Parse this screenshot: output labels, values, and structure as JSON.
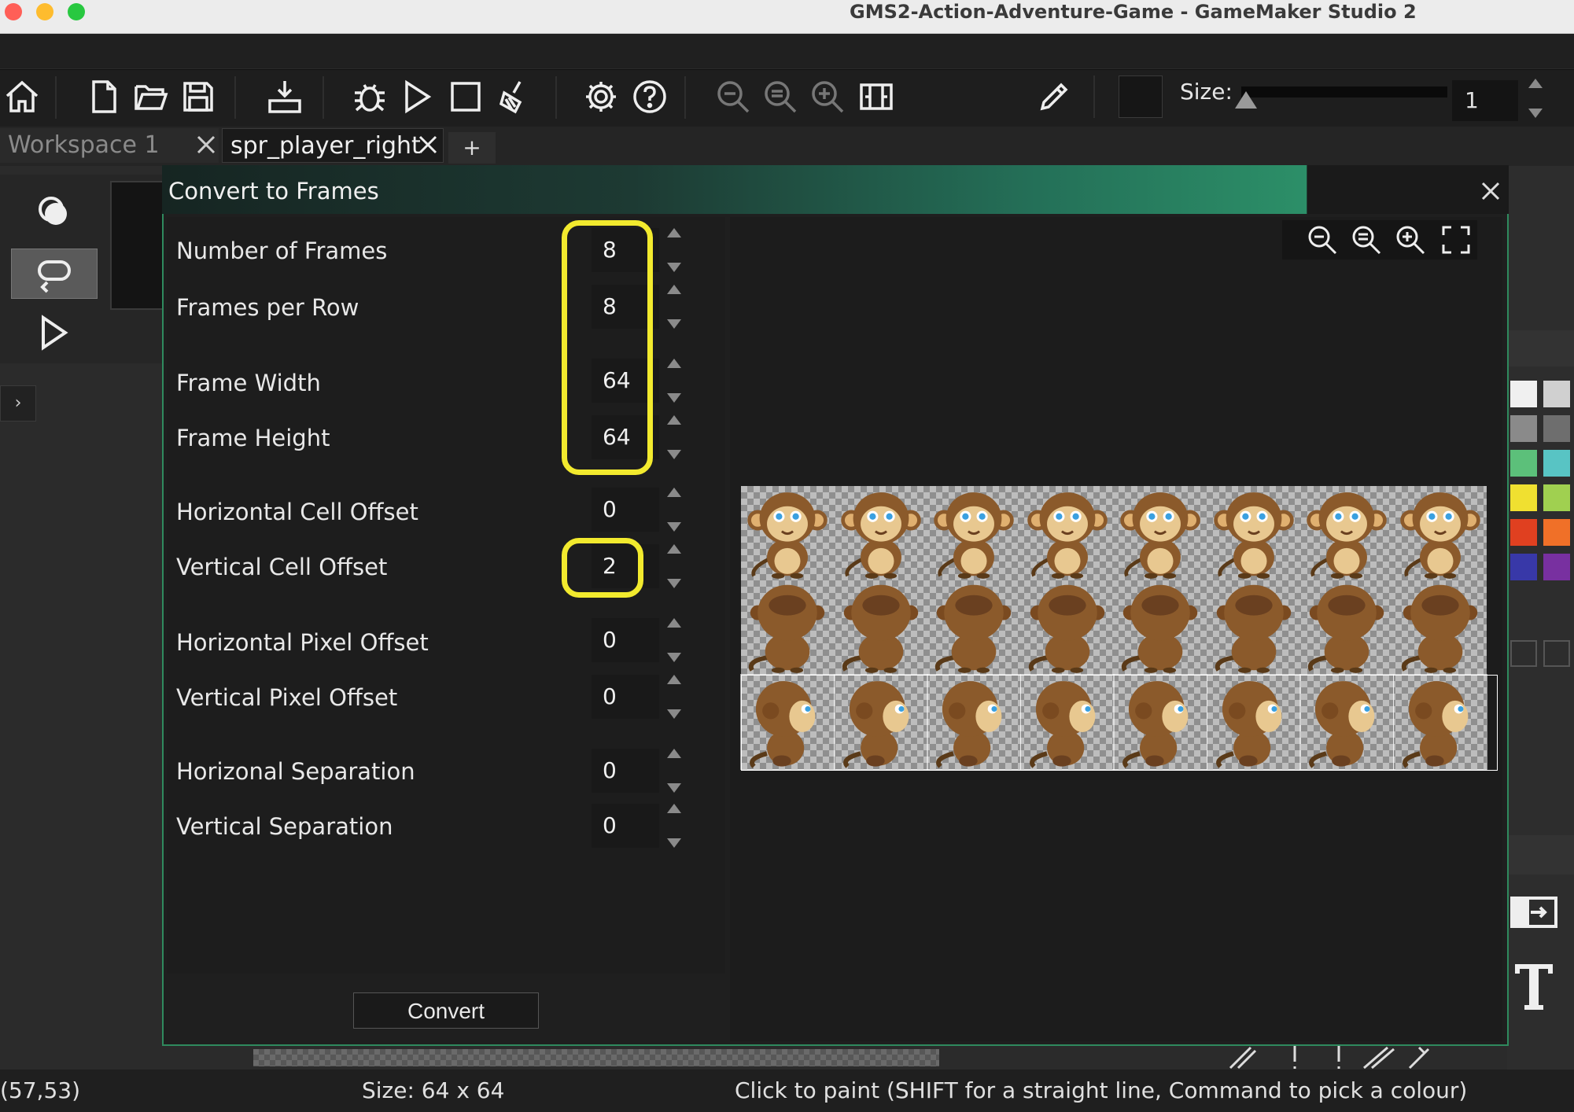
{
  "window": {
    "title": "GMS2-Action-Adventure-Game - GameMaker Studio 2",
    "traffic_colors": [
      "#ff5f57",
      "#febc2e",
      "#28c840"
    ]
  },
  "toolbar": {
    "icons": [
      "home-icon",
      "new-file-icon",
      "open-folder-icon",
      "save-icon",
      "export-icon",
      "debug-icon",
      "run-icon",
      "stop-icon",
      "clean-icon",
      "settings-icon",
      "help-icon",
      "zoom-out-icon",
      "zoom-reset-icon",
      "zoom-in-icon",
      "fit-icon",
      "pencil-icon"
    ],
    "size_label": "Size:",
    "size_value": "1"
  },
  "tabs": [
    {
      "label": "Workspace 1",
      "active": false
    },
    {
      "label": "spr_player_right",
      "active": true
    }
  ],
  "tab_add": "+",
  "left_tools": {
    "expand_glyph": "›"
  },
  "dialog": {
    "title": "Convert to Frames",
    "close": "✕",
    "fields": [
      {
        "label": "Number of Frames",
        "value": "8"
      },
      {
        "label": "Frames per Row",
        "value": "8"
      },
      {
        "label": "Frame Width",
        "value": "64"
      },
      {
        "label": "Frame Height",
        "value": "64"
      },
      {
        "label": "Horizontal Cell Offset",
        "value": "0"
      },
      {
        "label": "Vertical Cell Offset",
        "value": "2"
      },
      {
        "label": "Horizontal Pixel Offset",
        "value": "0"
      },
      {
        "label": "Vertical Pixel Offset",
        "value": "0"
      },
      {
        "label": "Horizonal Separation",
        "value": "0"
      },
      {
        "label": "Vertical Separation",
        "value": "0"
      }
    ],
    "convert_label": "Convert",
    "highlight_color": "#f2ea2e",
    "accent_color": "#2f8a5e"
  },
  "statusbar": {
    "coords": "(57,53)",
    "size": "Size: 64 x 64",
    "hint": "Click to paint (SHIFT for a straight line, Command to pick a colour)"
  },
  "palette": [
    "#f0f0f0",
    "#d0d0d0",
    "#8a8a8a",
    "#6e6e6e",
    "#5cc07a",
    "#58c4c4",
    "#4aa8e8",
    "#f0e030",
    "#a0d050",
    "#50c060",
    "#e04020",
    "#f07028",
    "#f08828",
    "#3838a8",
    "#7830a0",
    "#b030a0"
  ]
}
